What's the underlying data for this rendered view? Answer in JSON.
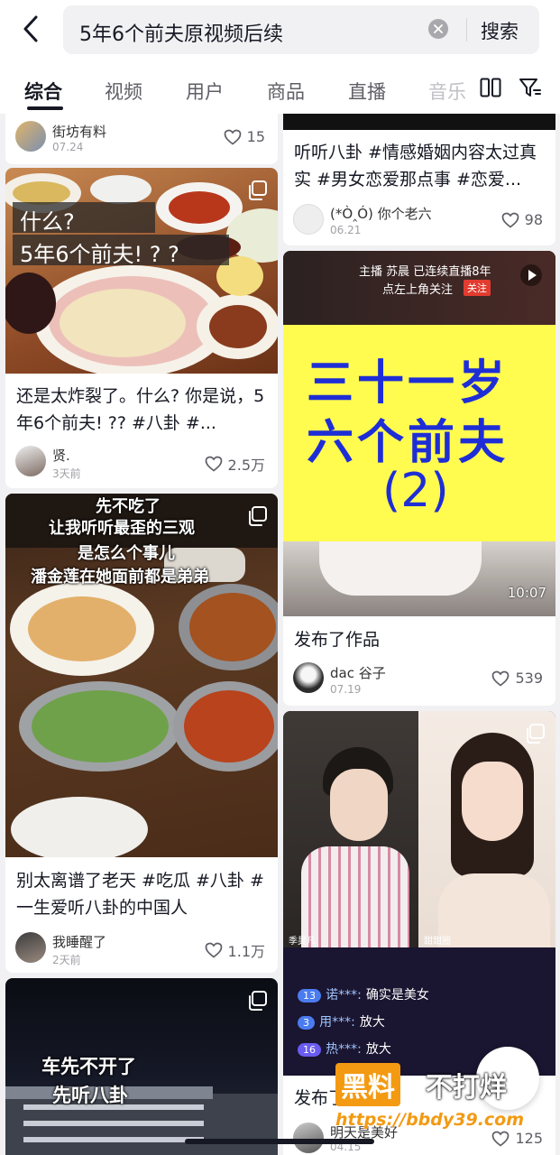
{
  "search": {
    "query": "5年6个前夫原视频后续",
    "button": "搜索"
  },
  "tabs": [
    "综合",
    "视频",
    "用户",
    "商品",
    "直播",
    "音乐"
  ],
  "left": [
    {
      "author": "街坊有料",
      "date": "07.24",
      "likes": "15"
    },
    {
      "overlay_1": "什么?",
      "overlay_2": "5年6个前夫! ? ?",
      "title": "还是太炸裂了。什么? 你是说，5年6个前夫! ?? #八卦 #...",
      "author": "贤.",
      "date": "3天前",
      "likes": "2.5万"
    },
    {
      "overlay_lines": [
        "先不吃了",
        "让我听听最歪的三观",
        "是怎么个事儿",
        "潘金莲在她面前都是弟弟"
      ],
      "title": "别太离谱了老天 #吃瓜 #八卦 #一生爱听八卦的中国人",
      "author": "我睡醒了",
      "date": "2天前",
      "likes": "1.1万"
    },
    {
      "overlay_1": "车先不开了",
      "overlay_2": "先听八卦"
    }
  ],
  "right": [
    {
      "title": "听听八卦 #情感婚姻内容太过真实 #男女恋爱那点事 #恋爱...",
      "author": "(*Ò‸Ó) 你个老六",
      "date": "06.21",
      "likes": "98"
    },
    {
      "live_banner": "主播 苏晨 已连续直播8年",
      "live_banner_2": "点左上角关注",
      "follow": "关注",
      "big_1": "三十一岁",
      "big_2": "六个前夫",
      "big_3": "(2)",
      "duration": "10:07",
      "title": "发布了作品",
      "author": "dac 谷子",
      "date": "07.19",
      "likes": "539"
    },
    {
      "caption_left": "季昊凡",
      "caption_right": "甜甜圈",
      "comments": [
        {
          "level": "13",
          "user": "诺***:",
          "text": "确实是美女"
        },
        {
          "level": "3",
          "user": "用***:",
          "text": "放大"
        },
        {
          "level": "16",
          "user": "热***:",
          "text": "放大"
        }
      ],
      "title": "发布了作品",
      "author": "明天是美好",
      "date": "04.15",
      "likes": "125"
    }
  ],
  "watermark": {
    "brand": "黑料",
    "slogan": "不打烊",
    "url": "https://bbdy39.com"
  },
  "colors": {
    "accent": "#161823",
    "yellow": "#fffb4f",
    "blue_text": "#1e2ed6",
    "wm_orange": "#f39a12"
  }
}
